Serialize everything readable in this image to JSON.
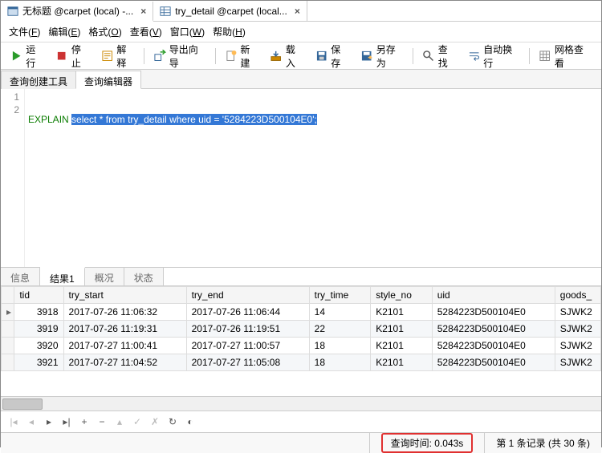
{
  "doc_tabs": [
    {
      "label": "无标题 @carpet (local) -...",
      "active": true
    },
    {
      "label": "try_detail @carpet (local...",
      "active": false
    }
  ],
  "menu": [
    {
      "t": "文件",
      "k": "F"
    },
    {
      "t": "编辑",
      "k": "E"
    },
    {
      "t": "格式",
      "k": "O"
    },
    {
      "t": "查看",
      "k": "V"
    },
    {
      "t": "窗口",
      "k": "W"
    },
    {
      "t": "帮助",
      "k": "H"
    }
  ],
  "toolbar": {
    "run": "运行",
    "stop": "停止",
    "explain": "解释",
    "export_wizard": "导出向导",
    "new": "新建",
    "load": "载入",
    "save": "保存",
    "save_as": "另存为",
    "find": "查找",
    "wrap": "自动换行",
    "grid_view": "网格查看"
  },
  "sub_tabs": [
    "查询创建工具",
    "查询编辑器"
  ],
  "active_sub_tab": 1,
  "code": {
    "lines": [
      "1",
      "2"
    ],
    "keyword": "EXPLAIN",
    "selected": "select * from try_detail where uid = '5284223D500104E0';"
  },
  "result_tabs": [
    "信息",
    "结果1",
    "概况",
    "状态"
  ],
  "active_result_tab": 1,
  "grid": {
    "columns": [
      "tid",
      "try_start",
      "try_end",
      "try_time",
      "style_no",
      "uid",
      "goods_"
    ],
    "widths": [
      60,
      150,
      150,
      75,
      75,
      150,
      56
    ],
    "rows": [
      {
        "tid": "3918",
        "try_start": "2017-07-26 11:06:32",
        "try_end": "2017-07-26 11:06:44",
        "try_time": "14",
        "style_no": "K2101",
        "uid": "5284223D500104E0",
        "goods_": "SJWK2"
      },
      {
        "tid": "3919",
        "try_start": "2017-07-26 11:19:31",
        "try_end": "2017-07-26 11:19:51",
        "try_time": "22",
        "style_no": "K2101",
        "uid": "5284223D500104E0",
        "goods_": "SJWK2"
      },
      {
        "tid": "3920",
        "try_start": "2017-07-27 11:00:41",
        "try_end": "2017-07-27 11:00:57",
        "try_time": "18",
        "style_no": "K2101",
        "uid": "5284223D500104E0",
        "goods_": "SJWK2"
      },
      {
        "tid": "3921",
        "try_start": "2017-07-27 11:04:52",
        "try_end": "2017-07-27 11:05:08",
        "try_time": "18",
        "style_no": "K2101",
        "uid": "5284223D500104E0",
        "goods_": "SJWK2"
      }
    ]
  },
  "status": {
    "query_time": "查询时间: 0.043s",
    "record_info": "第 1 条记录 (共 30 条)"
  }
}
